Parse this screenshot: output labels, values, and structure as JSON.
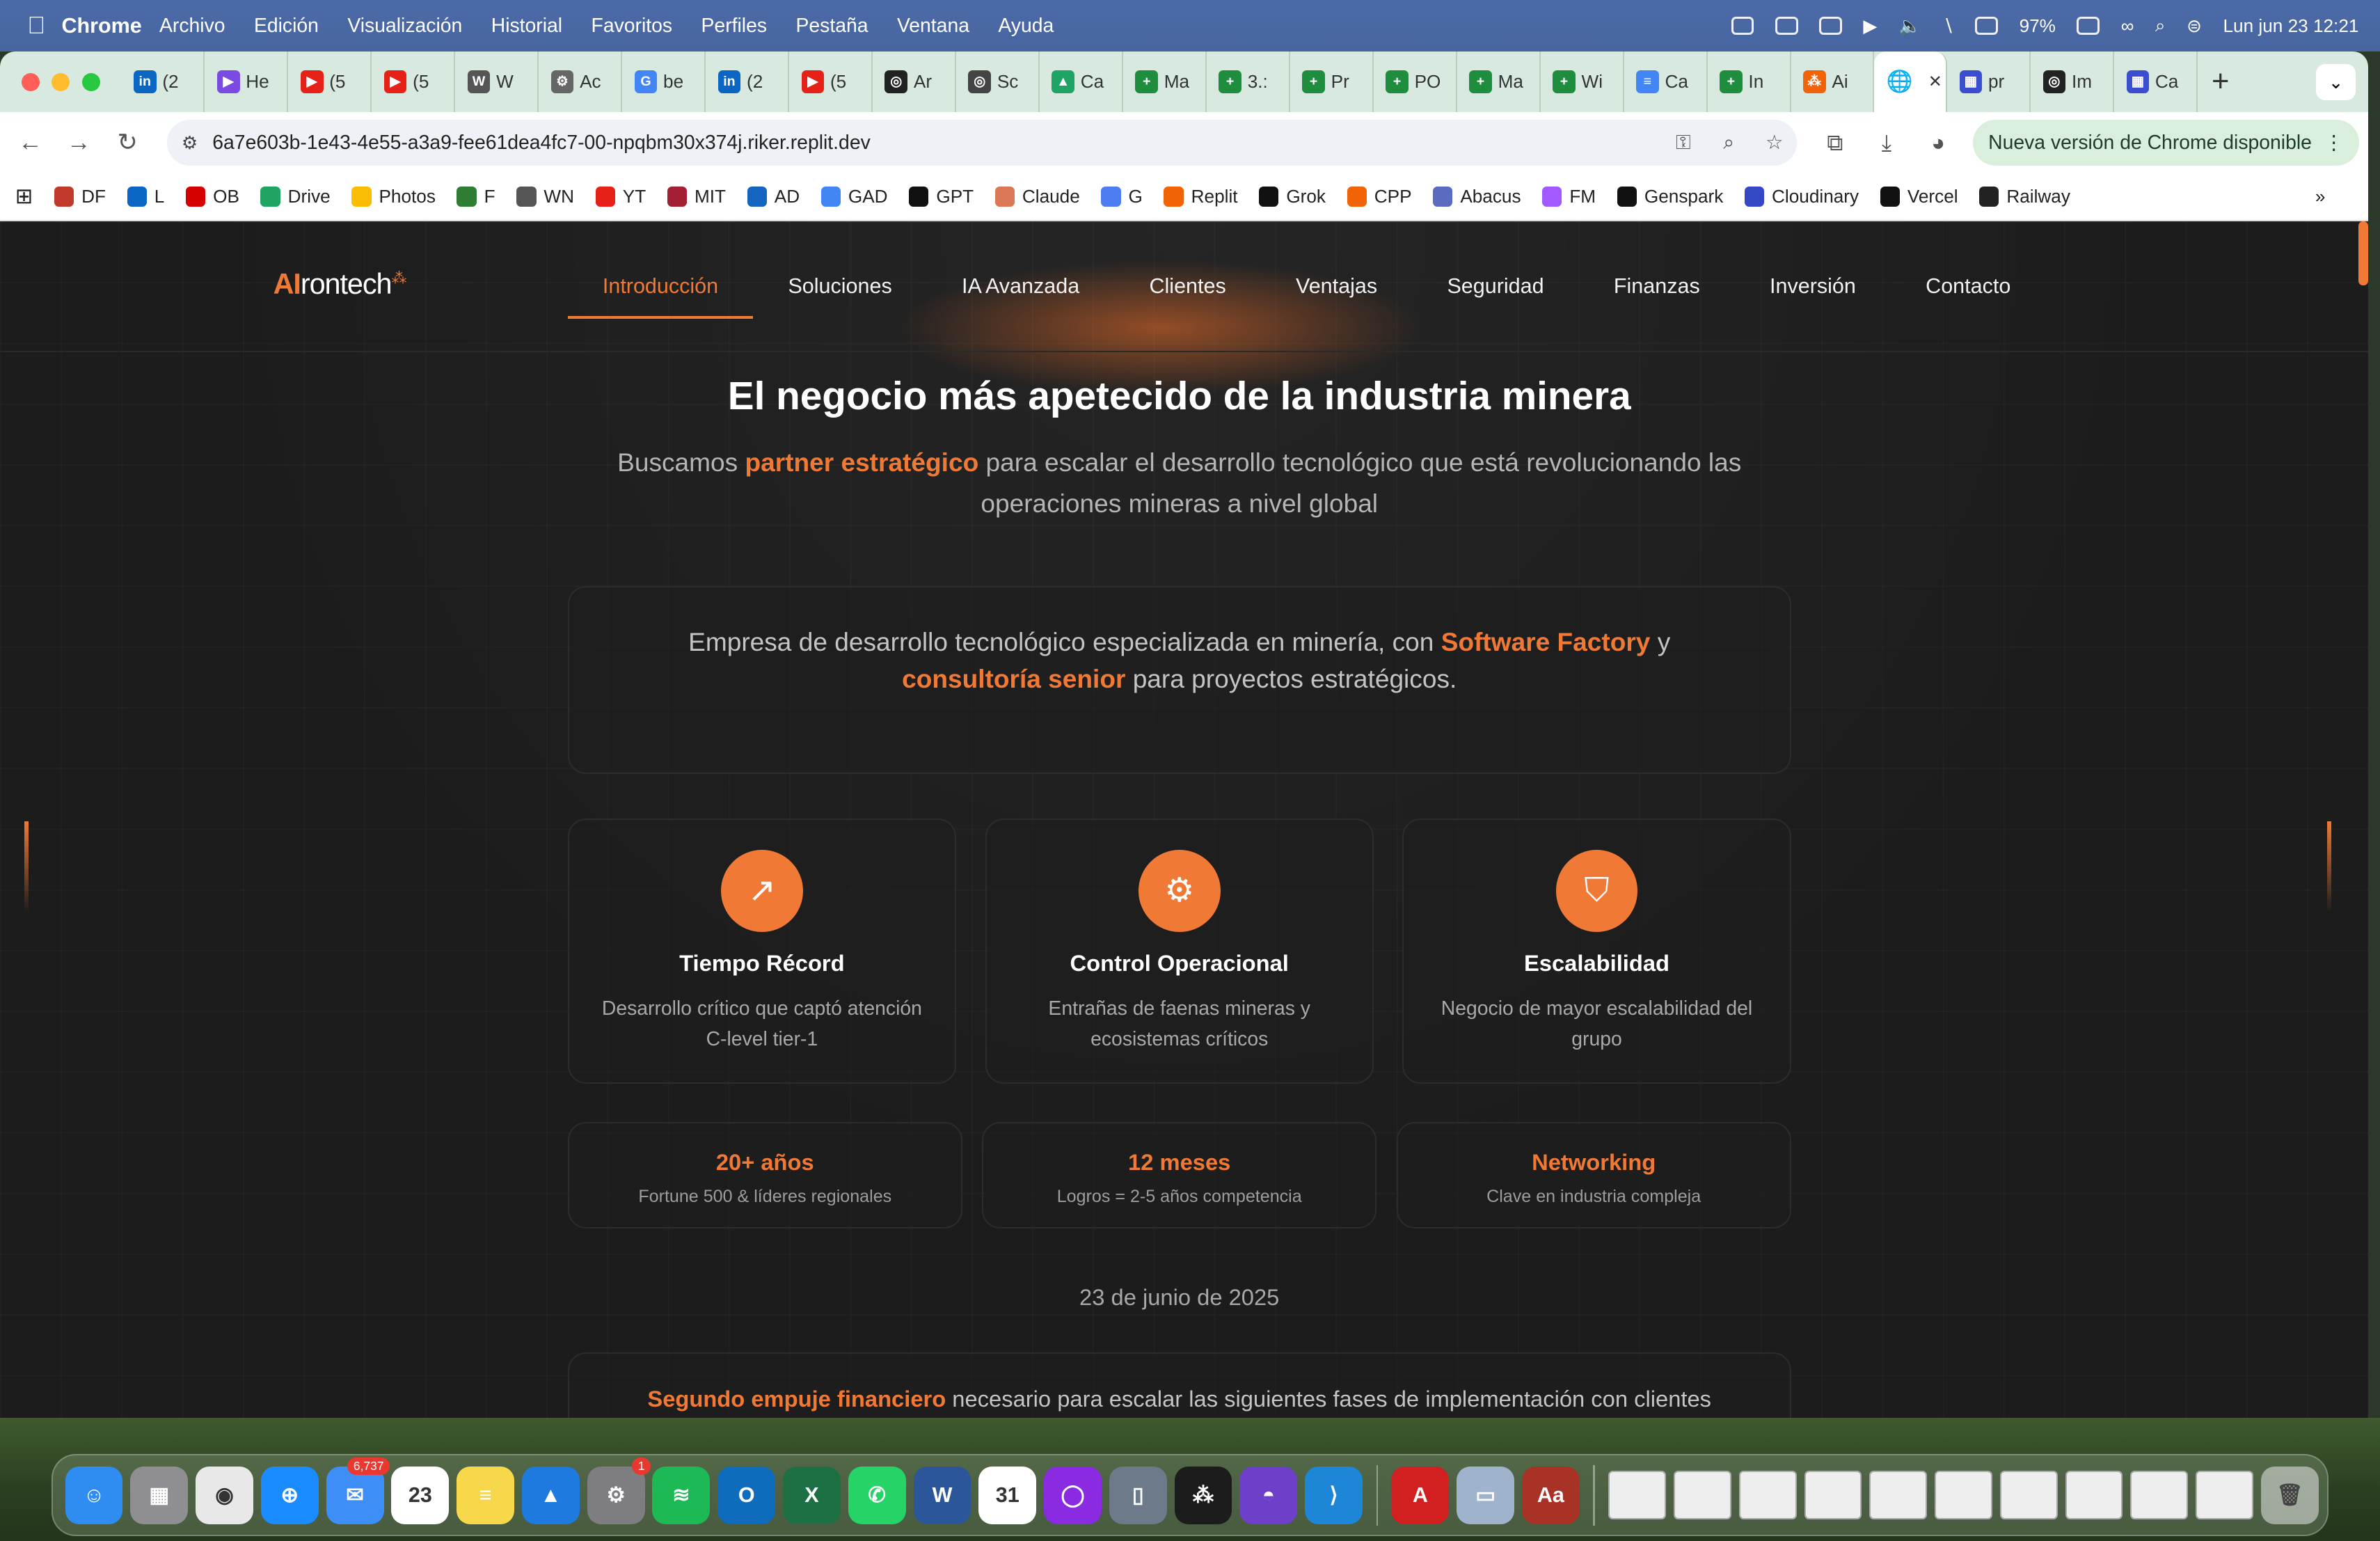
{
  "menubar": {
    "app_name": "Chrome",
    "menus": [
      "Archivo",
      "Edición",
      "Visualización",
      "Historial",
      "Favoritos",
      "Perfiles",
      "Pestaña",
      "Ventana",
      "Ayuda"
    ],
    "battery": "97%",
    "datetime": "Lun jun 23  12:21"
  },
  "tabs": [
    {
      "label": "(2",
      "color": "#0a66c2",
      "glyph": "in"
    },
    {
      "label": "He",
      "color": "#7b4ae2",
      "glyph": "▶"
    },
    {
      "label": "(5",
      "color": "#e62117",
      "glyph": "▶"
    },
    {
      "label": "(5",
      "color": "#e62117",
      "glyph": "▶"
    },
    {
      "label": "W",
      "color": "#555555",
      "glyph": "W"
    },
    {
      "label": "Ac",
      "color": "#666666",
      "glyph": "⚙"
    },
    {
      "label": "be",
      "color": "#4285f4",
      "glyph": "G"
    },
    {
      "label": "(2",
      "color": "#0a66c2",
      "glyph": "in"
    },
    {
      "label": "(5",
      "color": "#e62117",
      "glyph": "▶"
    },
    {
      "label": "Ar",
      "color": "#222222",
      "glyph": "◎"
    },
    {
      "label": "Sc",
      "color": "#444444",
      "glyph": "◎"
    },
    {
      "label": "Ca",
      "color": "#1fa463",
      "glyph": "▲"
    },
    {
      "label": "Ma",
      "color": "#1e8e3e",
      "glyph": "+"
    },
    {
      "label": "3.:",
      "color": "#1e8e3e",
      "glyph": "+"
    },
    {
      "label": "Pr",
      "color": "#1e8e3e",
      "glyph": "+"
    },
    {
      "label": "PO",
      "color": "#1e8e3e",
      "glyph": "+"
    },
    {
      "label": "Ma",
      "color": "#1e8e3e",
      "glyph": "+"
    },
    {
      "label": "Wi",
      "color": "#1e8e3e",
      "glyph": "+"
    },
    {
      "label": "Ca",
      "color": "#4285f4",
      "glyph": "≡"
    },
    {
      "label": "In",
      "color": "#1e8e3e",
      "glyph": "+"
    },
    {
      "label": "Ai",
      "color": "#f26207",
      "glyph": "⁂"
    }
  ],
  "tabs_after": [
    {
      "label": "pr",
      "color": "#3a4ecf",
      "glyph": "▦"
    },
    {
      "label": "Im",
      "color": "#222222",
      "glyph": "◎"
    },
    {
      "label": "Ca",
      "color": "#3a4ecf",
      "glyph": "▦"
    }
  ],
  "active_tab": {
    "close": "✕"
  },
  "omnibox": {
    "url": "6a7e603b-1e43-4e55-a3a9-fee61dea4fc7-00-npqbm30x374j.riker.replit.dev"
  },
  "update_button": "Nueva versión de Chrome disponible",
  "bookmarks": [
    {
      "label": "DF",
      "color": "#c0392b"
    },
    {
      "label": "L",
      "color": "#0a66c2"
    },
    {
      "label": "OB",
      "color": "#d50000"
    },
    {
      "label": "Drive",
      "color": "#1fa463"
    },
    {
      "label": "Photos",
      "color": "#fbbc04"
    },
    {
      "label": "F",
      "color": "#2e7d32"
    },
    {
      "label": "WN",
      "color": "#555555"
    },
    {
      "label": "YT",
      "color": "#e62117"
    },
    {
      "label": "MIT",
      "color": "#a31f34"
    },
    {
      "label": "AD",
      "color": "#1565c0"
    },
    {
      "label": "GAD",
      "color": "#4285f4"
    },
    {
      "label": "GPT",
      "color": "#111111"
    },
    {
      "label": "Claude",
      "color": "#d97757"
    },
    {
      "label": "G",
      "color": "#4e7df1"
    },
    {
      "label": "Replit",
      "color": "#f26207"
    },
    {
      "label": "Grok",
      "color": "#111111"
    },
    {
      "label": "CPP",
      "color": "#f26207"
    },
    {
      "label": "Abacus",
      "color": "#5b6bc0"
    },
    {
      "label": "FM",
      "color": "#a259ff"
    },
    {
      "label": "Genspark",
      "color": "#111111"
    },
    {
      "label": "Cloudinary",
      "color": "#3448c5"
    },
    {
      "label": "Vercel",
      "color": "#111111"
    },
    {
      "label": "Railway",
      "color": "#222222"
    }
  ],
  "site": {
    "logo_ai": "AI",
    "logo_rest": "rontech",
    "nav": [
      "Introducción",
      "Soluciones",
      "IA Avanzada",
      "Clientes",
      "Ventajas",
      "Seguridad",
      "Finanzas",
      "Inversión",
      "Contacto"
    ],
    "active_nav": "Introducción",
    "hero_title": "El negocio más apetecido de la industria minera",
    "hero_sub_pre": "Buscamos ",
    "hero_sub_hi": "partner estratégico",
    "hero_sub_post": " para escalar el desarrollo tecnológico que está revolucionando las operaciones mineras a nivel global",
    "intro_pre": "Empresa de desarrollo tecnológico especializada en minería, con ",
    "intro_hi1": "Software Factory",
    "intro_mid": " y ",
    "intro_hi2": "consultoría senior",
    "intro_post": " para proyectos estratégicos.",
    "features": [
      {
        "icon": "trending-up-icon",
        "title": "Tiempo Récord",
        "desc": "Desarrollo crítico que captó atención C-level tier-1"
      },
      {
        "icon": "gear-icon",
        "title": "Control Operacional",
        "desc": "Entrañas de faenas mineras y ecosistemas críticos"
      },
      {
        "icon": "shield-icon",
        "title": "Escalabilidad",
        "desc": "Negocio de mayor escalabilidad del grupo"
      }
    ],
    "stats": [
      {
        "value": "20+ años",
        "label": "Fortune 500 & líderes regionales"
      },
      {
        "value": "12 meses",
        "label": "Logros = 2-5 años competencia"
      },
      {
        "value": "Networking",
        "label": "Clave en industria compleja"
      }
    ],
    "date": "23 de junio de 2025",
    "bottom_hi": "Segundo empuje financiero",
    "bottom_post": " necesario para escalar las siguientes fases de implementación con clientes",
    "accent": "#f07a35"
  },
  "dock": {
    "apps": [
      {
        "name": "finder",
        "color": "#2f8cf0",
        "glyph": "☺"
      },
      {
        "name": "launchpad",
        "color": "#8e8e93",
        "glyph": "▦"
      },
      {
        "name": "chrome",
        "color": "#e8e8e8",
        "glyph": "◉"
      },
      {
        "name": "safari",
        "color": "#1a8cff",
        "glyph": "⊕"
      },
      {
        "name": "mail",
        "color": "#3d8ef7",
        "glyph": "✉",
        "badge": "6,737"
      },
      {
        "name": "calendar",
        "color": "#ffffff",
        "glyph": "23"
      },
      {
        "name": "notes",
        "color": "#f7d84a",
        "glyph": "≡"
      },
      {
        "name": "keynote",
        "color": "#1f7ae0",
        "glyph": "▲"
      },
      {
        "name": "system-settings",
        "color": "#7d7d82",
        "glyph": "⚙",
        "badge": "1"
      },
      {
        "name": "spotify",
        "color": "#1db954",
        "glyph": "≋"
      },
      {
        "name": "outlook",
        "color": "#0f6cbd",
        "glyph": "O"
      },
      {
        "name": "excel",
        "color": "#1d7044",
        "glyph": "X"
      },
      {
        "name": "whatsapp",
        "color": "#25d366",
        "glyph": "✆"
      },
      {
        "name": "word",
        "color": "#2b579a",
        "glyph": "W"
      },
      {
        "name": "fantastical",
        "color": "#ffffff",
        "glyph": "31"
      },
      {
        "name": "circle-app",
        "color": "#8a2be2",
        "glyph": "◯"
      },
      {
        "name": "iphone-mirroring",
        "color": "#6c7a89",
        "glyph": "▯"
      },
      {
        "name": "replit",
        "color": "#1c1c1c",
        "glyph": "⁂"
      },
      {
        "name": "github-desktop",
        "color": "#6e40c9",
        "glyph": "◓"
      },
      {
        "name": "vscode",
        "color": "#1e86d6",
        "glyph": "⟩"
      },
      {
        "name": "acrobat",
        "color": "#d21f1f",
        "glyph": "A"
      },
      {
        "name": "preview",
        "color": "#9fb4cc",
        "glyph": "▭"
      },
      {
        "name": "dictionary",
        "color": "#a93226",
        "glyph": "Aa"
      }
    ]
  }
}
